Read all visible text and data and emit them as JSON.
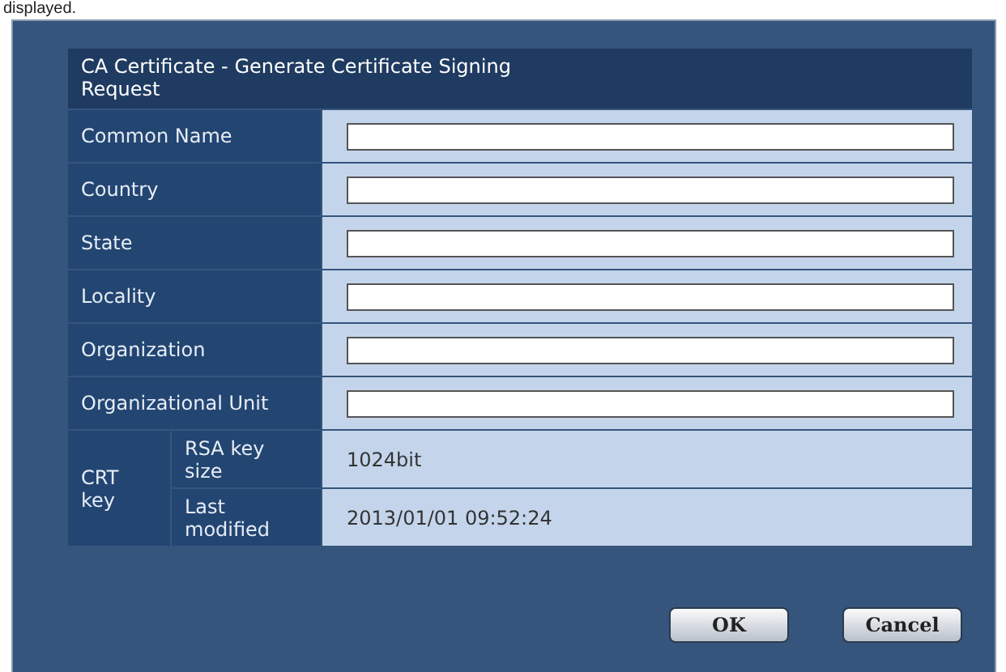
{
  "caption": "displayed.",
  "dialog": {
    "title": "CA Certificate - Generate Certificate Signing Request",
    "fields": [
      {
        "label": "Common Name"
      },
      {
        "label": "Country"
      },
      {
        "label": "State"
      },
      {
        "label": "Locality"
      },
      {
        "label": "Organization"
      },
      {
        "label": "Organizational Unit"
      }
    ],
    "crt_key": {
      "label": "CRT key",
      "rows": [
        {
          "label": "RSA key size",
          "value": "1024bit"
        },
        {
          "label": "Last modified",
          "value": "2013/01/01 09:52:24"
        }
      ]
    },
    "buttons": [
      "OK",
      "Cancel"
    ]
  }
}
